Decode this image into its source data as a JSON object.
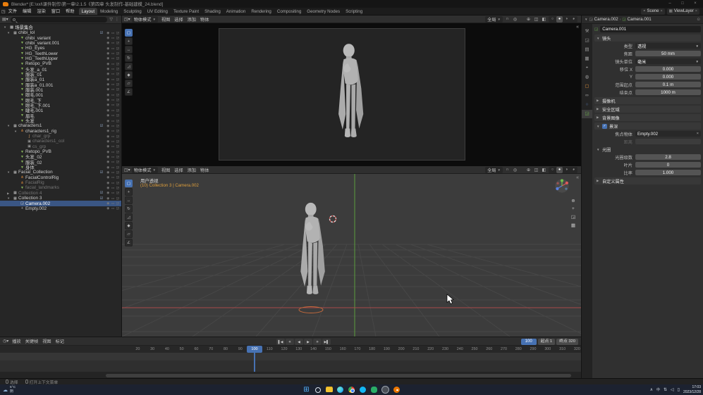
{
  "titlebar": {
    "title": "Blender*  [E:\\xxl\\课件制作\\第一章\\2.1.5《第四章 头发制作-基础建模_24.blend]"
  },
  "topbar": {
    "menus": [
      "文件",
      "编辑",
      "渲染",
      "窗口",
      "帮助"
    ],
    "workspaces": [
      {
        "label": "Layout",
        "active": true
      },
      {
        "label": "Modeling"
      },
      {
        "label": "Sculpting"
      },
      {
        "label": "UV Editing"
      },
      {
        "label": "Texture Paint"
      },
      {
        "label": "Shading"
      },
      {
        "label": "Animation"
      },
      {
        "label": "Rendering"
      },
      {
        "label": "Compositing"
      },
      {
        "label": "Geometry Nodes"
      },
      {
        "label": "Scripting"
      }
    ],
    "scene_label": "Scene",
    "viewlayer_label": "ViewLayer"
  },
  "outliner": {
    "root_label": "场景集合",
    "items": [
      {
        "label": "chibi_lol",
        "icon": "collection",
        "depth": 0,
        "expander": "▼",
        "check": true
      },
      {
        "label": "chibi_variant",
        "icon": "mesh",
        "depth": 1
      },
      {
        "label": "chibi_variant.001",
        "icon": "mesh",
        "depth": 1
      },
      {
        "label": "HG_Eyes",
        "icon": "mesh",
        "depth": 1
      },
      {
        "label": "HG_TeethLower",
        "icon": "mesh",
        "depth": 1
      },
      {
        "label": "HG_TeethUpper",
        "icon": "mesh",
        "depth": 1
      },
      {
        "label": "Retopo_PVB",
        "icon": "mesh",
        "depth": 1
      },
      {
        "label": "头发_a_01",
        "icon": "mesh",
        "depth": 1
      },
      {
        "label": "服装_01",
        "icon": "mesh",
        "depth": 1
      },
      {
        "label": "服装a_01",
        "icon": "mesh",
        "depth": 1
      },
      {
        "label": "服装a_01.001",
        "icon": "mesh",
        "depth": 1
      },
      {
        "label": "服装.001",
        "icon": "mesh",
        "depth": 1
      },
      {
        "label": "眼毛.001",
        "icon": "mesh",
        "depth": 1
      },
      {
        "label": "眼毛_下",
        "icon": "mesh",
        "depth": 1
      },
      {
        "label": "眼毛_下.001",
        "icon": "mesh",
        "depth": 1
      },
      {
        "label": "睫毛.001",
        "icon": "mesh",
        "depth": 1
      },
      {
        "label": "眉毛",
        "icon": "mesh",
        "depth": 1
      },
      {
        "label": "头发",
        "icon": "mesh",
        "depth": 1
      },
      {
        "label": "characters1",
        "icon": "collection",
        "depth": 0,
        "expander": "▼",
        "check": true
      },
      {
        "label": "characters1_rig",
        "icon": "armature",
        "depth": 1,
        "expander": "▼"
      },
      {
        "label": "char_grp",
        "icon": "bone",
        "depth": 2,
        "dim": true
      },
      {
        "label": "characters1_col",
        "icon": "group",
        "depth": 2,
        "dim": true
      },
      {
        "label": "cs_grp",
        "icon": "group",
        "depth": 2,
        "dim": true
      },
      {
        "label": "Retopo_PVB",
        "icon": "mesh",
        "depth": 1
      },
      {
        "label": "头发_02",
        "icon": "mesh",
        "depth": 1
      },
      {
        "label": "服装_02",
        "icon": "mesh",
        "depth": 1
      },
      {
        "label": "身体",
        "icon": "mesh",
        "depth": 1
      },
      {
        "label": "Facial_Collection",
        "icon": "collection",
        "depth": 0,
        "expander": "▼",
        "check": true
      },
      {
        "label": "FacialControlRig",
        "icon": "armature",
        "depth": 1
      },
      {
        "label": "FacialRig",
        "icon": "armature",
        "depth": 1,
        "dim": true
      },
      {
        "label": "facial_landmarks",
        "icon": "mesh",
        "depth": 1,
        "dim": true
      },
      {
        "label": "Collection 4",
        "icon": "collection",
        "depth": 0,
        "expander": "▶",
        "dim": true,
        "check": true
      },
      {
        "label": "Collection 3",
        "icon": "collection",
        "depth": 0,
        "expander": "▼",
        "check": true
      },
      {
        "label": "Camera.002",
        "icon": "camera",
        "depth": 1,
        "selected": true
      },
      {
        "label": "Empty.002",
        "icon": "empty",
        "depth": 1
      }
    ]
  },
  "viewport": {
    "mode": "物体模式",
    "menus": [
      "视图",
      "选择",
      "添加",
      "物体"
    ],
    "orientation": "全局",
    "shading": [
      {
        "icon": "wireframe"
      },
      {
        "icon": "solid",
        "active": true
      },
      {
        "icon": "material"
      },
      {
        "icon": "rendered"
      }
    ],
    "tools": [
      {
        "icon": "box-select",
        "active": true
      },
      {
        "icon": "cursor"
      },
      {
        "icon": "move"
      },
      {
        "icon": "rotate"
      },
      {
        "icon": "scale"
      },
      {
        "icon": "transform"
      },
      {
        "icon": "annotate"
      },
      {
        "icon": "measure"
      }
    ],
    "overlay_perspective": "用户透视",
    "overlay_collection": "(10) Collection 3 | Camera.002"
  },
  "properties": {
    "breadcrumb": {
      "object": "Camera.002",
      "data": "Camera.001"
    },
    "name_field": "Camera.001",
    "tabs": [
      {
        "icon": "tool"
      },
      {
        "icon": "render"
      },
      {
        "icon": "output"
      },
      {
        "icon": "viewlayer"
      },
      {
        "icon": "scene"
      },
      {
        "icon": "world"
      },
      {
        "icon": "object"
      },
      {
        "icon": "constraints"
      },
      {
        "icon": "physics"
      },
      {
        "icon": "data",
        "active": true
      }
    ],
    "lens_title": "镜头",
    "lens_rows": [
      {
        "label": "类型",
        "value": "透视",
        "kind": "menu"
      },
      {
        "label": "焦距",
        "value": "50 mm",
        "kind": "number"
      },
      {
        "label": "镜头单位",
        "value": "毫米",
        "kind": "menu"
      },
      {
        "label": "移位 X",
        "value": "0.000",
        "kind": "number"
      },
      {
        "label": "Y",
        "value": "0.000",
        "kind": "number"
      },
      {
        "label": "范围起点",
        "value": "0.1 m",
        "kind": "number"
      },
      {
        "label": "结束点",
        "value": "1000 m",
        "kind": "number"
      }
    ],
    "collapsed_sections": [
      "摄像机",
      "安全区域",
      "背景图像"
    ],
    "dof_title": "景深",
    "dof_rows": [
      {
        "label": "焦点物体",
        "value": "Empty.002",
        "kind": "object"
      },
      {
        "label": "距离",
        "value": "",
        "kind": "number",
        "disabled": true
      }
    ],
    "aperture_title": "光圈",
    "aperture_rows": [
      {
        "label": "光圈级数",
        "value": "2.8",
        "kind": "number"
      },
      {
        "label": "叶片",
        "value": "0",
        "kind": "number"
      },
      {
        "label": "比率",
        "value": "1.000",
        "kind": "number"
      }
    ],
    "custom_props_title": "自定义属性"
  },
  "timeline": {
    "menus": [
      "播放",
      "关键帧",
      "视图",
      "标记"
    ],
    "transport": [
      {
        "icon": "jump-start"
      },
      {
        "icon": "prev-key"
      },
      {
        "icon": "play-reverse"
      },
      {
        "icon": "play"
      },
      {
        "icon": "next-key"
      },
      {
        "icon": "jump-end"
      }
    ],
    "current_frame": "100",
    "start_label": "起点 1",
    "end_label": "终点 320",
    "ruler": [
      20,
      30,
      40,
      50,
      60,
      70,
      80,
      90,
      100,
      110,
      120,
      130,
      140,
      150,
      160,
      170,
      180,
      190,
      200,
      210,
      220,
      230,
      240,
      250,
      260,
      270,
      280,
      290,
      300,
      310,
      320
    ]
  },
  "statusbar": {
    "items": [
      {
        "label": "选择"
      },
      {
        "label": "打开上下文菜单"
      }
    ]
  },
  "taskbar": {
    "weather_temp": "5°C",
    "weather_desc": "阴",
    "apps": [
      {
        "icon": "start"
      },
      {
        "icon": "search"
      },
      {
        "icon": "explorer"
      },
      {
        "icon": "edge"
      },
      {
        "icon": "chrome"
      },
      {
        "icon": "qq"
      },
      {
        "icon": "wechat"
      },
      {
        "icon": "obs"
      },
      {
        "icon": "blender",
        "open": true
      }
    ],
    "tray": {
      "lang": "中",
      "time": "17:03",
      "date": "2023/12/28"
    }
  }
}
